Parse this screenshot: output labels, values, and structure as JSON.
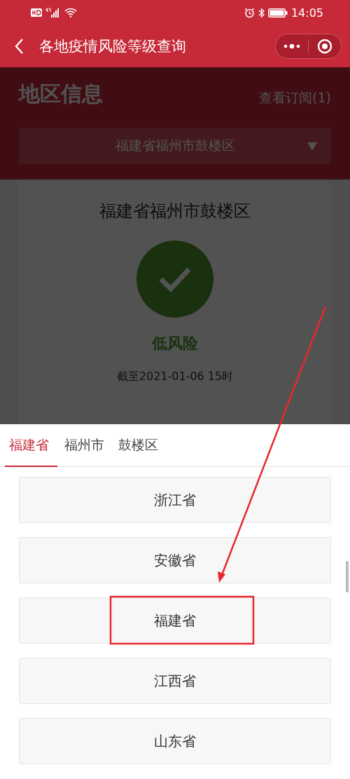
{
  "status_bar": {
    "time": "14:05"
  },
  "nav_bar": {
    "title": "各地疫情风险等级查询"
  },
  "region_info": {
    "heading": "地区信息",
    "subscription_link": "查看订阅(1)",
    "region_select": {
      "value": "福建省福州市鼓楼区"
    },
    "card": {
      "region": "福建省福州市鼓楼区",
      "risk_level": "低风险",
      "updated": "截至2021-01-06 15时"
    }
  },
  "picker": {
    "tabs": [
      {
        "label": "福建省",
        "selected": true
      },
      {
        "label": "福州市",
        "selected": false
      },
      {
        "label": "鼓楼区",
        "selected": false
      }
    ],
    "options": [
      "浙江省",
      "安徽省",
      "福建省",
      "江西省",
      "山东省"
    ]
  }
}
